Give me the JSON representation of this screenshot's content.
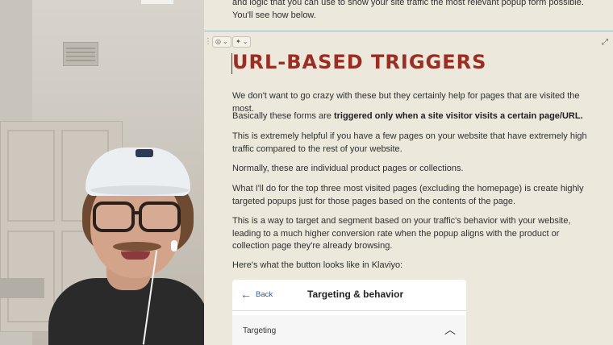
{
  "document": {
    "intro_text": "and logic that you can use to show your site traffic the most relevant popup form possible. You'll see how below.",
    "heading": "URL-BASED TRIGGERS",
    "paragraphs": {
      "p1": "We don't want to go crazy with these but they certainly help for pages that are visited the most.",
      "p2_start": "Basically these forms are ",
      "p2_bold": "triggered only when a site visitor visits a certain page/URL.",
      "p3": "This is extremely helpful if you have a few pages on your website that have extremely high traffic compared to the rest of your website.",
      "p4": "Normally, these are individual product pages or collections.",
      "p5": "What I'll do for the top three most visited pages (excluding the homepage) is create highly targeted popups just for those pages based on the contents of the page.",
      "p6": "This is a way to target and segment based on your traffic's behavior with your website, leading to a much higher conversion rate when the popup aligns with the product or collection page they're already browsing.",
      "p7": "Here's what the button looks like in Klaviyo:"
    },
    "toolbar": {
      "palette_icon": "palette-icon",
      "magic_icon": "sparkle-icon",
      "expand_icon": "expand-icon"
    }
  },
  "klaviyo_screenshot": {
    "back_label": "Back",
    "title": "Targeting & behavior",
    "section_label": "Targeting"
  },
  "colors": {
    "heading": "#9b2d22",
    "doc_bg": "#ece8dc",
    "link_blue": "#2f5b9a"
  }
}
